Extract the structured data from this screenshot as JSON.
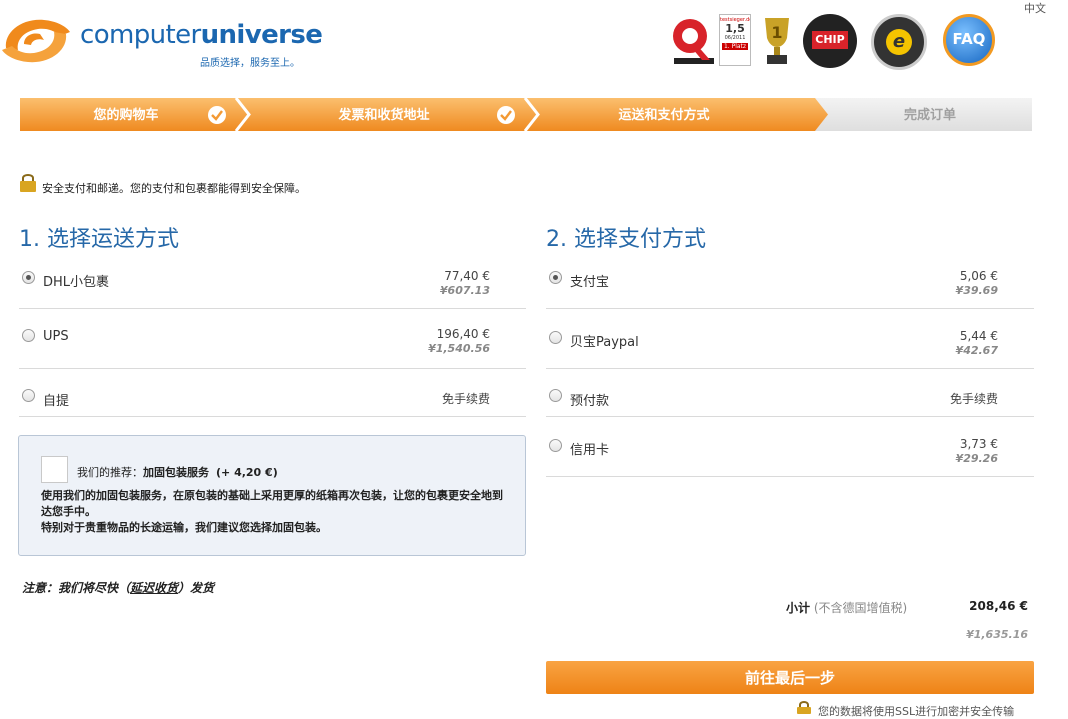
{
  "header": {
    "logo_text_light": "computer",
    "logo_text_bold": "universe",
    "slogan": "品质选择，服务至上。",
    "language": "中文",
    "badges": {
      "testsieger": {
        "top": "testsieger.de",
        "grade": "1,5",
        "date": "06/2011",
        "rank": "1. Platz"
      },
      "chip": "CHIP",
      "trusted": "TRUSTED SHOPS",
      "faq": "FAQ"
    }
  },
  "steps": [
    {
      "label": "您的购物车",
      "done": true
    },
    {
      "label": "发票和收货地址",
      "done": true
    },
    {
      "label": "运送和支付方式",
      "active": true
    },
    {
      "label": "完成订单",
      "inactive": true
    }
  ],
  "security_notice": "安全支付和邮递。您的支付和包裹都能得到安全保障。",
  "shipping": {
    "title": "1. 选择运送方式",
    "options": [
      {
        "label": "DHL小包裹",
        "price": "77,40 €",
        "price_rmb": "¥607.13",
        "selected": true
      },
      {
        "label": "UPS",
        "price": "196,40 €",
        "price_rmb": "¥1,540.56",
        "selected": false
      },
      {
        "label": "自提",
        "price": "免手续费",
        "price_rmb": "",
        "selected": false
      }
    ]
  },
  "payment": {
    "title": "2. 选择支付方式",
    "options": [
      {
        "label": "支付宝",
        "price": "5,06 €",
        "price_rmb": "¥39.69",
        "selected": true
      },
      {
        "label": "贝宝Paypal",
        "price": "5,44 €",
        "price_rmb": "¥42.67",
        "selected": false
      },
      {
        "label": "预付款",
        "price": "免手续费",
        "price_rmb": "",
        "selected": false
      },
      {
        "label": "信用卡",
        "price": "3,73 €",
        "price_rmb": "¥29.26",
        "selected": false
      }
    ]
  },
  "recommendation": {
    "prefix": "我们的推荐：",
    "title": "加固包装服务",
    "price": "(+ 4,20 €)",
    "body1": "使用我们的加固包装服务，在原包装的基础上采用更厚的纸箱再次包装，让您的包裹更安全地到达您手中。",
    "body2": "特别对于贵重物品的长途运输，我们建议您选择加固包装。"
  },
  "note": {
    "prefix": "注意：我们将尽快（",
    "link": "延迟收货",
    "suffix": "）发货"
  },
  "subtotal": {
    "label": "小计",
    "sublabel": "(不含德国增值税)",
    "eur": "208,46 €",
    "rmb": "¥1,635.16"
  },
  "next_button": "前往最后一步",
  "ssl_notice": "您的数据将使用SSL进行加密并安全传输"
}
